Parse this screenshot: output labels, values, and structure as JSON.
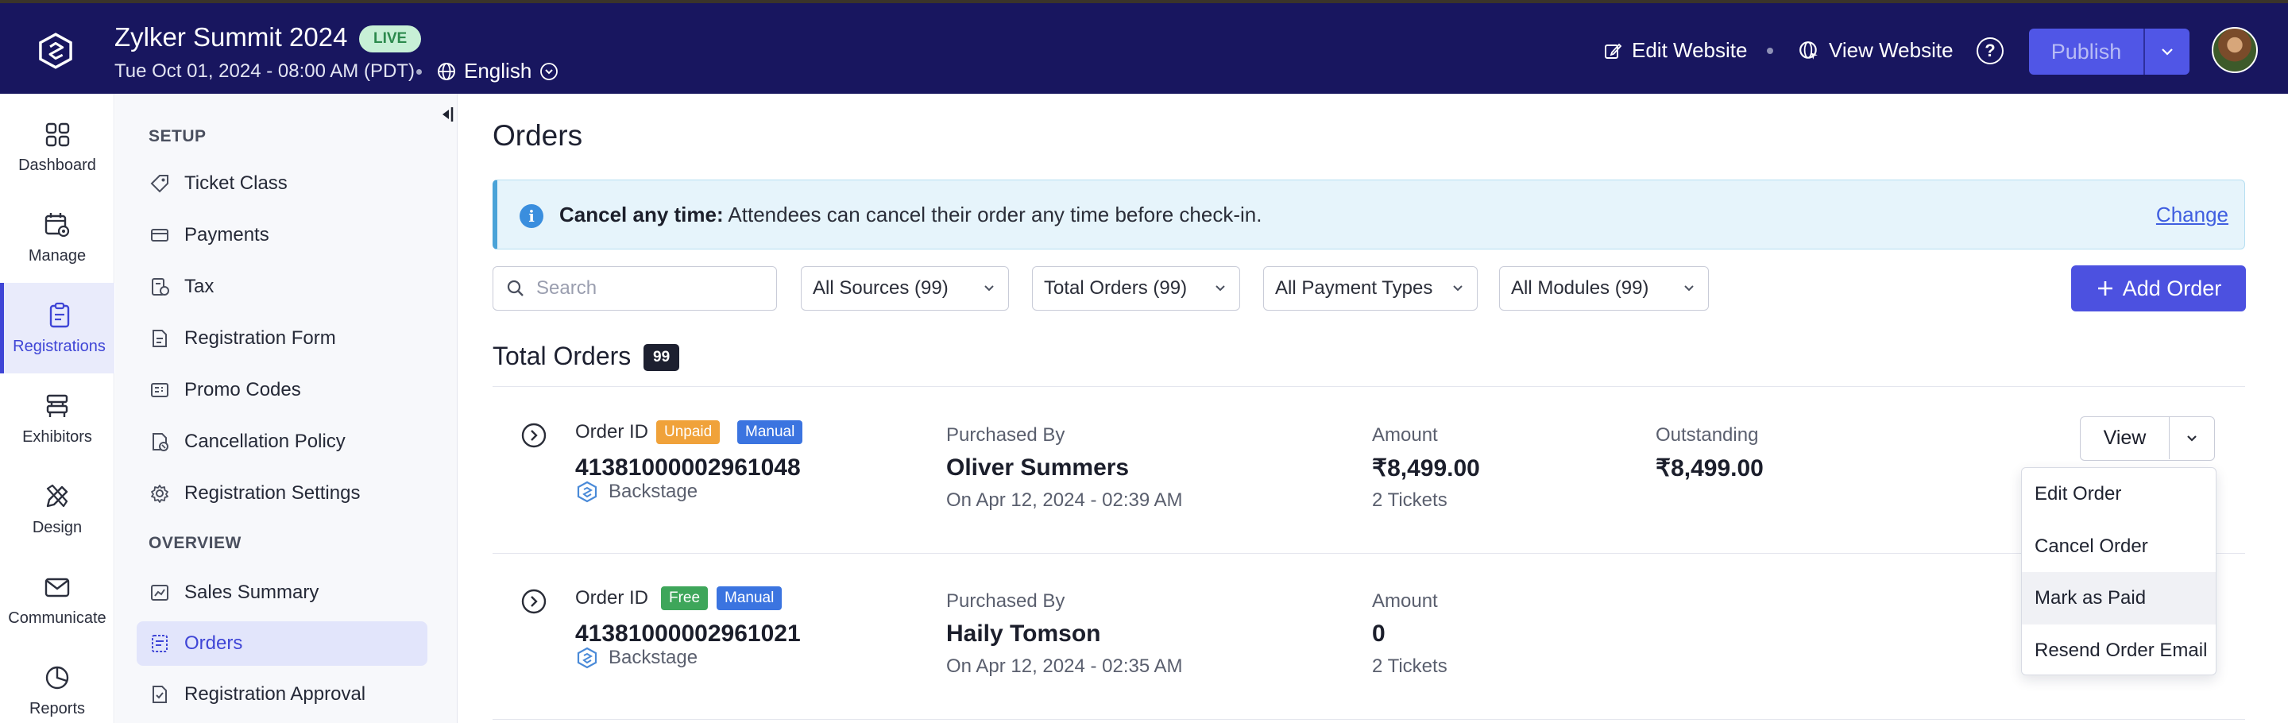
{
  "header": {
    "event_title": "Zylker Summit 2024",
    "live_badge": "LIVE",
    "event_date": "Tue Oct 01, 2024 - 08:00 AM (PDT)",
    "language": "English",
    "edit_website": "Edit Website",
    "view_website": "View Website",
    "help": "?",
    "publish": "Publish",
    "colors": {
      "bar": "#18165f",
      "publish": "#5056e6"
    }
  },
  "rail": {
    "items": [
      {
        "label": "Dashboard",
        "icon": "dashboard-icon"
      },
      {
        "label": "Manage",
        "icon": "calendar-gear-icon"
      },
      {
        "label": "Registrations",
        "icon": "clipboard-icon",
        "active": true
      },
      {
        "label": "Exhibitors",
        "icon": "booth-icon"
      },
      {
        "label": "Design",
        "icon": "pencil-ruler-icon"
      },
      {
        "label": "Communicate",
        "icon": "mail-icon"
      },
      {
        "label": "Reports",
        "icon": "pie-chart-icon"
      }
    ]
  },
  "subnav": {
    "setup_heading": "SETUP",
    "setup_items": [
      {
        "label": "Ticket Class",
        "icon": "ticket-icon"
      },
      {
        "label": "Payments",
        "icon": "card-icon"
      },
      {
        "label": "Tax",
        "icon": "tax-icon"
      },
      {
        "label": "Registration Form",
        "icon": "form-icon"
      },
      {
        "label": "Promo Codes",
        "icon": "promo-icon"
      },
      {
        "label": "Cancellation Policy",
        "icon": "policy-icon"
      },
      {
        "label": "Registration Settings",
        "icon": "gear-icon"
      }
    ],
    "overview_heading": "OVERVIEW",
    "overview_items": [
      {
        "label": "Sales Summary",
        "icon": "chart-icon"
      },
      {
        "label": "Orders",
        "icon": "orders-icon",
        "active": true
      },
      {
        "label": "Registration Approval",
        "icon": "approval-icon"
      }
    ]
  },
  "main": {
    "title": "Orders",
    "banner": {
      "bold": "Cancel any time:",
      "text": " Attendees can cancel their order any time before check-in.",
      "link": "Change"
    },
    "search_placeholder": "Search",
    "filters": [
      "All Sources (99)",
      "Total Orders (99)",
      "All Payment Types",
      "All Modules (99)"
    ],
    "add_order": "Add Order",
    "total_title": "Total Orders",
    "total_count": "99",
    "orders": [
      {
        "order_id_label": "Order ID",
        "tags": [
          {
            "text": "Unpaid",
            "color": "#f0a23a"
          },
          {
            "text": "Manual",
            "color": "#3b74e0"
          }
        ],
        "order_id": "41381000002961048",
        "source": "Backstage",
        "purchased_by_label": "Purchased By",
        "purchased_by": "Oliver Summers",
        "purchased_on": "On Apr 12, 2024 - 02:39 AM",
        "amount_label": "Amount",
        "amount": "₹8,499.00",
        "tickets": "2 Tickets",
        "outstanding_label": "Outstanding",
        "outstanding": "₹8,499.00",
        "view": "View"
      },
      {
        "order_id_label": "Order ID",
        "tags": [
          {
            "text": "Free",
            "color": "#3ea65a"
          },
          {
            "text": "Manual",
            "color": "#3b74e0"
          }
        ],
        "order_id": "41381000002961021",
        "source": "Backstage",
        "purchased_by_label": "Purchased By",
        "purchased_by": "Haily Tomson",
        "purchased_on": "On Apr 12, 2024 - 02:35 AM",
        "amount_label": "Amount",
        "amount": "0",
        "tickets": "2 Tickets"
      }
    ],
    "dropdown_menu": [
      "Edit Order",
      "Cancel Order",
      "Mark as Paid",
      "Resend Order Email"
    ]
  }
}
